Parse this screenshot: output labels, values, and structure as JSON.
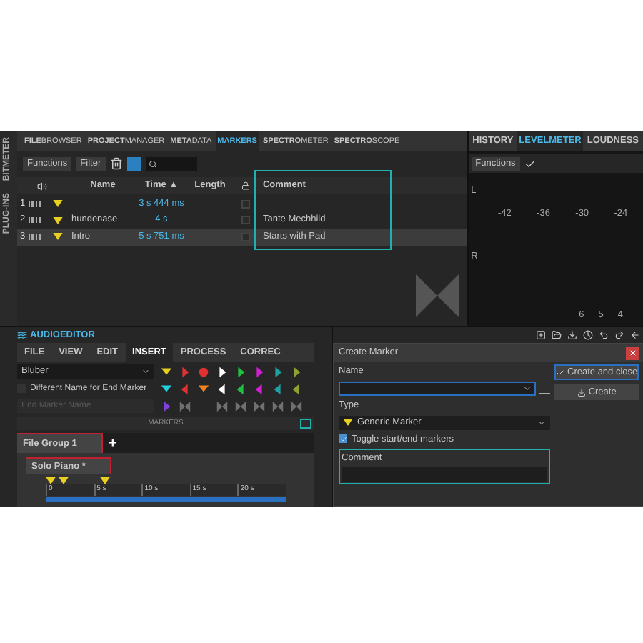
{
  "side_strip": {
    "labels": [
      "BITMETER",
      "PLUG-INS"
    ]
  },
  "markers_panel": {
    "tabs": [
      {
        "label": "**FILE**BROWSER",
        "selected": false
      },
      {
        "label": "**PROJECT**MANAGER",
        "selected": false
      },
      {
        "label": "**META**DATA",
        "selected": false
      },
      {
        "label": "**MARKERS**",
        "selected": true
      },
      {
        "label": "**SPECTRO**METER",
        "selected": false
      },
      {
        "label": "**SPECTRO**SCOPE",
        "selected": false
      }
    ],
    "toolbar": {
      "buttons": [
        "Functions",
        "Filter"
      ]
    },
    "columns": [
      "Name",
      "Time ▲",
      "Length",
      "Comment"
    ],
    "rows": [
      {
        "index": "1",
        "name": "",
        "time": "3 s 444 ms",
        "locked": false,
        "comment": "",
        "selected": false
      },
      {
        "index": "2",
        "name": "hundenase",
        "time": "4 s",
        "locked": false,
        "comment": "Tante Mechhild",
        "selected": false
      },
      {
        "index": "3",
        "name": "Intro",
        "time": "5 s 751 ms",
        "locked": false,
        "comment": "Starts with Pad",
        "selected": true
      }
    ]
  },
  "meter_panel": {
    "tabs": [
      {
        "label": "HISTORY",
        "selected": false
      },
      {
        "label": "LEVELMETER",
        "selected": true
      },
      {
        "label": "LOUDNESS",
        "selected": false
      }
    ],
    "toolbar": {
      "button": "Functions"
    },
    "channels": [
      "L",
      "R"
    ],
    "scale": [
      "-42",
      "-36",
      "-30",
      "-24"
    ],
    "bottom_scale": [
      "6",
      "5",
      "4"
    ]
  },
  "audio_editor": {
    "title": "AUDIOEDITOR",
    "tabs": [
      {
        "label": "FILE",
        "selected": false
      },
      {
        "label": "VIEW",
        "selected": false
      },
      {
        "label": "EDIT",
        "selected": false
      },
      {
        "label": "INSERT",
        "selected": true
      },
      {
        "label": "PROCESS",
        "selected": false
      },
      {
        "label": "CORREC",
        "selected": false
      }
    ],
    "name_field": {
      "value": "Bluber"
    },
    "end_name_checkbox": {
      "label": "Different Name for End Marker",
      "checked": false
    },
    "end_name_field": {
      "placeholder": "End Marker Name",
      "disabled": true
    },
    "marker_buttons": [
      [
        {
          "kind": "down",
          "color": "#e8d020"
        },
        {
          "kind": "right",
          "color": "#e03030"
        },
        {
          "kind": "circle",
          "color": "#e03030"
        },
        {
          "kind": "right",
          "color": "#ffffff"
        },
        {
          "kind": "right",
          "color": "#20c040"
        },
        {
          "kind": "right",
          "color": "#d020d0"
        },
        {
          "kind": "right",
          "color": "#20a0a0"
        },
        {
          "kind": "right",
          "color": "#90a030"
        }
      ],
      [
        {
          "kind": "down",
          "color": "#20d0e0"
        },
        {
          "kind": "left",
          "color": "#e03030"
        },
        {
          "kind": "down",
          "color": "#f08020"
        },
        {
          "kind": "left",
          "color": "#ffffff"
        },
        {
          "kind": "left",
          "color": "#20c040"
        },
        {
          "kind": "left",
          "color": "#d020d0"
        },
        {
          "kind": "left",
          "color": "#20a0a0"
        },
        {
          "kind": "left",
          "color": "#90a030"
        }
      ],
      [
        {
          "kind": "right",
          "color": "#8040e0"
        },
        {
          "kind": "bowtie",
          "color": "#707070"
        },
        {
          "kind": "none"
        },
        {
          "kind": "bowtie",
          "color": "#707070"
        },
        {
          "kind": "bowtie",
          "color": "#707070"
        },
        {
          "kind": "bowtie",
          "color": "#707070"
        },
        {
          "kind": "bowtie",
          "color": "#707070"
        },
        {
          "kind": "bowtie",
          "color": "#707070"
        }
      ]
    ],
    "section_label": "MARKERS",
    "file_group_tab": "File Group 1",
    "add_tab": "+",
    "track_tab": "Solo Piano *",
    "ruler": [
      "0",
      "5 s",
      "10 s",
      "15 s",
      "20 s"
    ]
  },
  "dialog": {
    "title": "Create Marker",
    "name_label": "Name",
    "type_label": "Type",
    "type_value": "Generic Marker",
    "toggle": {
      "label": "Toggle start/end markers",
      "checked": true
    },
    "comment_label": "Comment",
    "buttons": [
      {
        "label": "Create and close",
        "kind": "primary"
      },
      {
        "label": "Create",
        "kind": "secondary"
      }
    ]
  }
}
